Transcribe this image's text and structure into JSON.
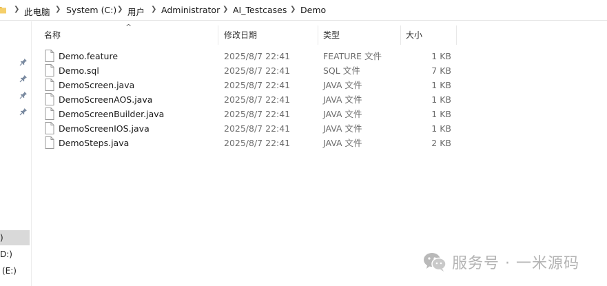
{
  "breadcrumb": [
    "此电脑",
    "System (C:)",
    "用户",
    "Administrator",
    "AI_Testcases",
    "Demo"
  ],
  "nav": {
    "drives": [
      ")",
      "D:)",
      "(E:)"
    ],
    "selected_index": 0
  },
  "columns": {
    "name": "名称",
    "date": "修改日期",
    "type": "类型",
    "size": "大小",
    "sort_indicator": "^"
  },
  "files": [
    {
      "name": "Demo.feature",
      "date": "2025/8/7 22:41",
      "type": "FEATURE 文件",
      "size": "1 KB"
    },
    {
      "name": "Demo.sql",
      "date": "2025/8/7 22:41",
      "type": "SQL 文件",
      "size": "7 KB"
    },
    {
      "name": "DemoScreen.java",
      "date": "2025/8/7 22:41",
      "type": "JAVA 文件",
      "size": "1 KB"
    },
    {
      "name": "DemoScreenAOS.java",
      "date": "2025/8/7 22:41",
      "type": "JAVA 文件",
      "size": "1 KB"
    },
    {
      "name": "DemoScreenBuilder.java",
      "date": "2025/8/7 22:41",
      "type": "JAVA 文件",
      "size": "1 KB"
    },
    {
      "name": "DemoScreenIOS.java",
      "date": "2025/8/7 22:41",
      "type": "JAVA 文件",
      "size": "1 KB"
    },
    {
      "name": "DemoSteps.java",
      "date": "2025/8/7 22:41",
      "type": "JAVA 文件",
      "size": "2 KB"
    }
  ],
  "watermark": {
    "text": "服务号 · 一米源码",
    "icon": "wechat-icon"
  },
  "colors": {
    "folder": "#e8b84a",
    "selected_nav": "#d9d9d9",
    "muted_text": "#6d6d6d"
  }
}
